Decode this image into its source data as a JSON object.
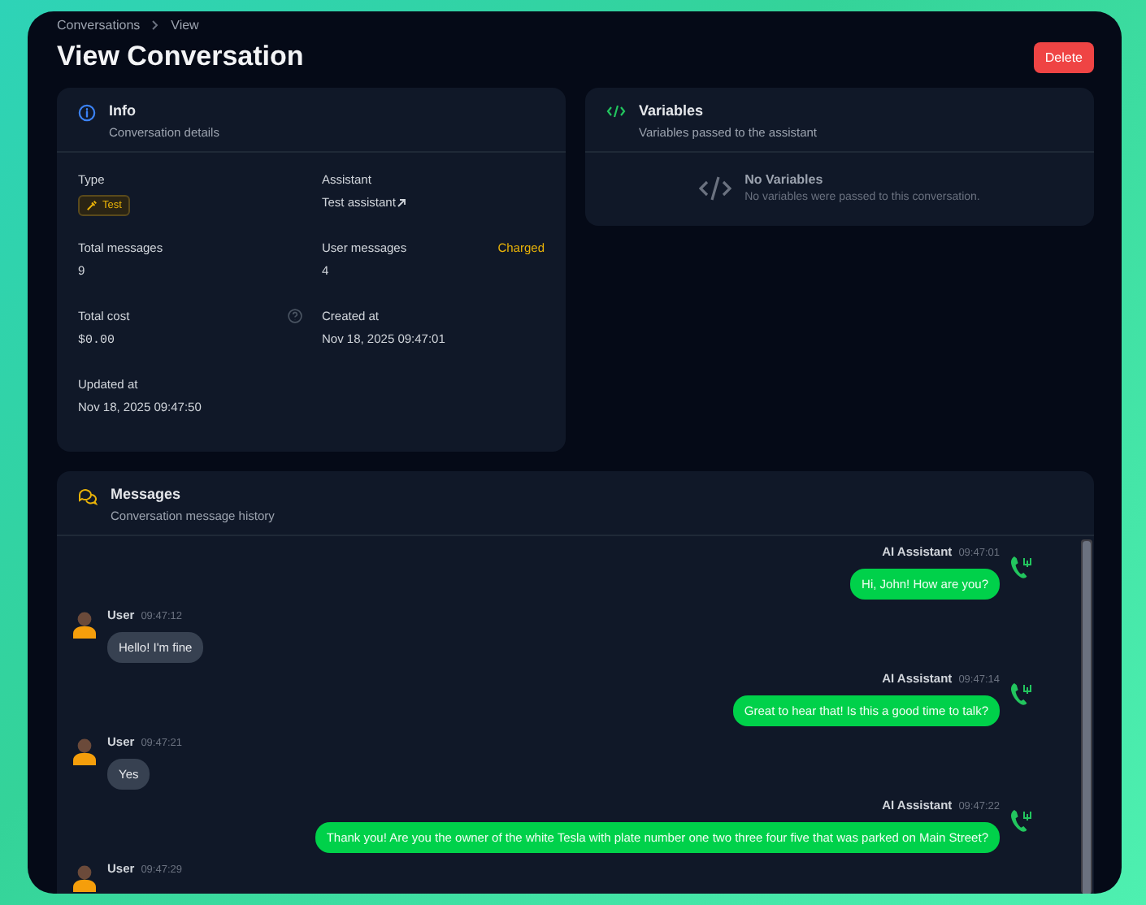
{
  "breadcrumb": [
    {
      "label": "Conversations"
    },
    {
      "label": "View"
    }
  ],
  "title": "View Conversation",
  "delete_button": "Delete",
  "info": {
    "title": "Info",
    "subtitle": "Conversation details",
    "fields": [
      {
        "label": "Type",
        "value": "Test",
        "kind": "badge"
      },
      {
        "label": "Assistant",
        "value": "Test assistant",
        "kind": "link"
      },
      {
        "label": "Total messages",
        "value": "9",
        "kind": "text"
      },
      {
        "label": "User messages",
        "value": "4",
        "kind": "text",
        "note": "Charged"
      },
      {
        "label": "Total cost",
        "value": "$0.00",
        "kind": "mono",
        "help_icon": true
      },
      {
        "label": "Created at",
        "value": "Nov 18, 2025 09:47:01",
        "kind": "text"
      },
      {
        "label": "Updated at",
        "value": "Nov 18, 2025 09:47:50",
        "kind": "text"
      }
    ]
  },
  "variables": {
    "title": "Variables",
    "subtitle": "Variables passed to the assistant",
    "empty_title": "No Variables",
    "empty_text": "No variables were passed to this conversation."
  },
  "messages": {
    "title": "Messages",
    "subtitle": "Conversation message history",
    "items": [
      {
        "kind": "assistant",
        "sender": "AI Assistant",
        "time": "09:47:01",
        "text": "Hi, John! How are you?"
      },
      {
        "kind": "user",
        "sender": "User",
        "time": "09:47:12",
        "text": "Hello! I'm fine"
      },
      {
        "kind": "assistant",
        "sender": "AI Assistant",
        "time": "09:47:14",
        "text": "Great to hear that! Is this a good time to talk?"
      },
      {
        "kind": "user",
        "sender": "User",
        "time": "09:47:21",
        "text": "Yes"
      },
      {
        "kind": "assistant",
        "sender": "AI Assistant",
        "time": "09:47:22",
        "text": "Thank you! Are you the owner of the white Tesla with plate number one two three four five that was parked on Main Street?"
      },
      {
        "kind": "user",
        "sender": "User",
        "time": "09:47:29"
      }
    ]
  }
}
